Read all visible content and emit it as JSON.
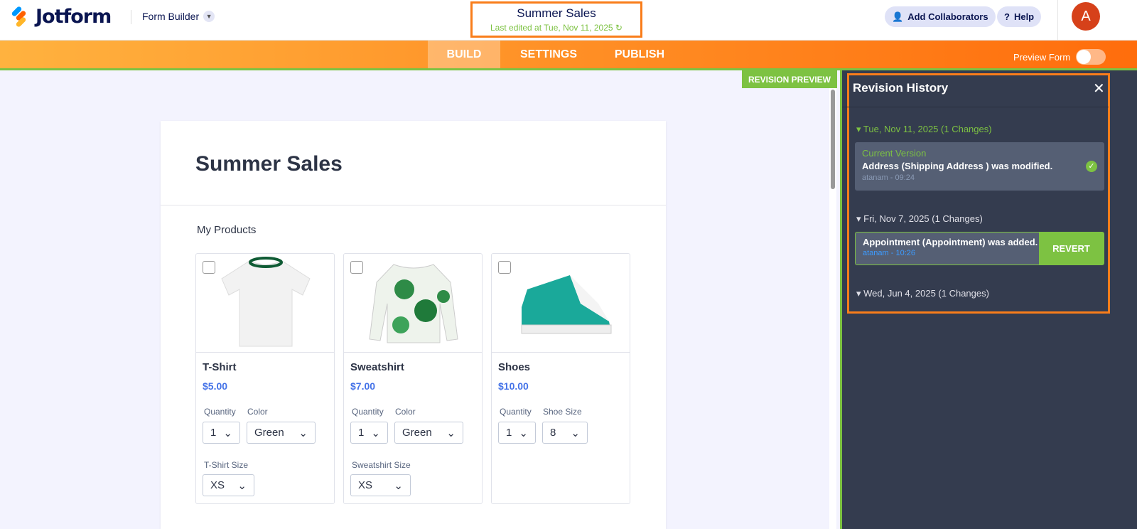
{
  "header": {
    "brand": "Jotform",
    "builder": "Form Builder",
    "form_title": "Summer Sales",
    "last_edited": "Last edited at Tue, Nov 11, 2025",
    "collab": "Add Collaborators",
    "help": "Help",
    "avatar": "A"
  },
  "nav": {
    "tabs": [
      "BUILD",
      "SETTINGS",
      "PUBLISH"
    ],
    "preview": "Preview Form"
  },
  "revision_preview": "REVISION PREVIEW",
  "history": {
    "title": "Revision History",
    "groups": [
      {
        "date": "Tue, Nov 11, 2025 (1 Changes)",
        "label": "Current Version",
        "change": "Address (Shipping Address ) was modified.",
        "meta": "atanam - 09:24"
      },
      {
        "date": "Fri, Nov 7, 2025 (1 Changes)",
        "change": "Appointment (Appointment) was added.",
        "meta": "atanam - 10:26",
        "action": "REVERT"
      },
      {
        "date": "Wed, Jun 4, 2025 (1 Changes)"
      }
    ]
  },
  "form": {
    "title": "Summer Sales",
    "section": "My Products",
    "products": [
      {
        "name": "T-Shirt",
        "price": "$5.00",
        "qty_label": "Quantity",
        "qty": "1",
        "opt_label": "Color",
        "opt": "Green",
        "size_label": "T-Shirt Size",
        "size": "XS"
      },
      {
        "name": "Sweatshirt",
        "price": "$7.00",
        "qty_label": "Quantity",
        "qty": "1",
        "opt_label": "Color",
        "opt": "Green",
        "size_label": "Sweatshirt Size",
        "size": "XS"
      },
      {
        "name": "Shoes",
        "price": "$10.00",
        "qty_label": "Quantity",
        "qty": "1",
        "opt_label": "Shoe Size",
        "opt": "8"
      }
    ]
  }
}
